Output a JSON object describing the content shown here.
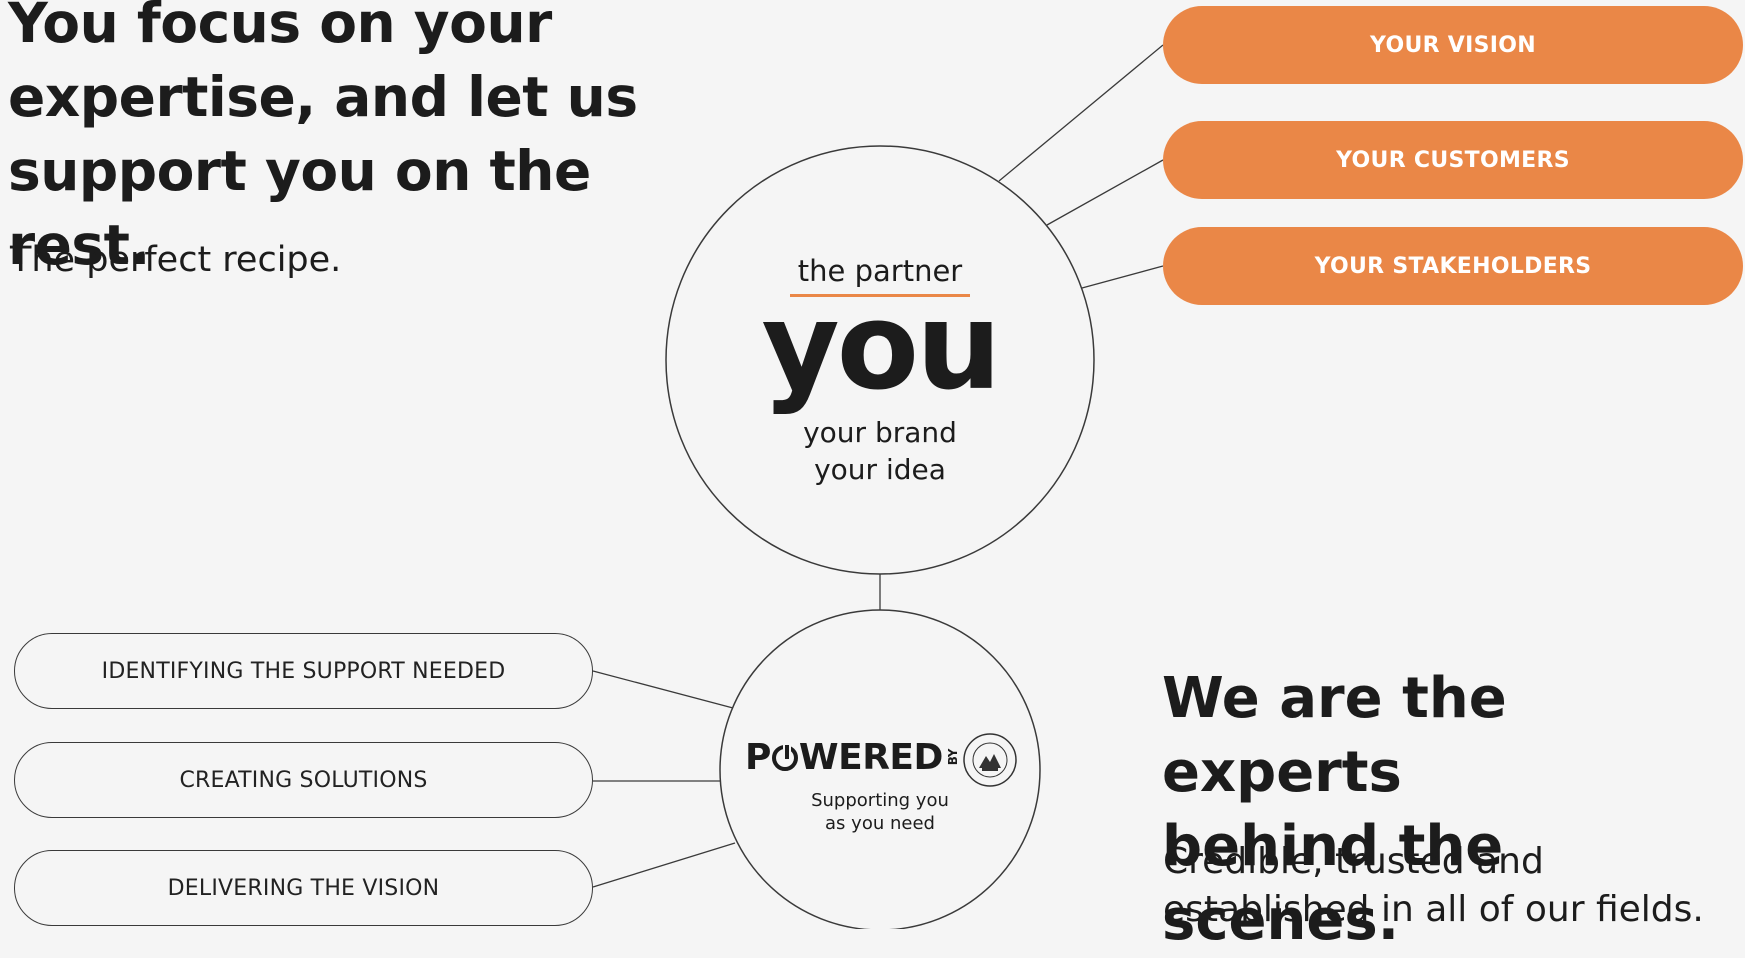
{
  "intro": {
    "headline_lines": [
      "You focus on your",
      "expertise, and let us",
      "support you on the rest."
    ],
    "subline": "The perfect recipe."
  },
  "partner_circle": {
    "label_top": "the partner",
    "big_word": "you",
    "line1": "your brand",
    "line2": "your idea"
  },
  "right_items": [
    {
      "label": "YOUR VISION"
    },
    {
      "label": "YOUR CUSTOMERS"
    },
    {
      "label": "YOUR STAKEHOLDERS"
    }
  ],
  "powered_circle": {
    "logo_text_pre": "P",
    "logo_text_post": "WERED",
    "logo_by": "BY",
    "seal_text": "SAY WE ARE • FORGE",
    "tagline_line1": "Supporting you",
    "tagline_line2": "as you need"
  },
  "left_items": [
    {
      "label": "IDENTIFYING THE SUPPORT NEEDED"
    },
    {
      "label": "CREATING SOLUTIONS"
    },
    {
      "label": "DELIVERING THE VISION"
    }
  ],
  "outro": {
    "headline_lines": [
      "We are the experts",
      "behind the scenes."
    ],
    "subline_lines": [
      "Credible, trusted and",
      "established in all of our fields."
    ]
  },
  "colors": {
    "accent": "#ea8747",
    "background": "#f5f5f5",
    "text": "#1c1c1c",
    "line": "#3a3a3a"
  }
}
